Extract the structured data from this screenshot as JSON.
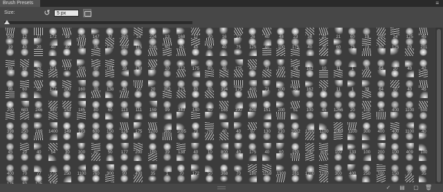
{
  "panel": {
    "tab_title": "Brush Presets",
    "menu_icon": "panel-menu-icon"
  },
  "toolbar": {
    "size_label": "Size:",
    "size_value": "5 px",
    "reset_icon": "reset-size-icon",
    "new_preset_icon": "create-new-preset-icon",
    "size_slider_position": 0
  },
  "brushes": {
    "rows": [
      [
        "500",
        "12",
        "77",
        "172",
        "99",
        "100",
        "147",
        "37",
        "360",
        "24",
        "224",
        "13",
        "168",
        "17",
        "30",
        "16",
        "22",
        "26",
        "40",
        "48",
        "23",
        "36",
        "21",
        "21",
        "60",
        "19",
        "100",
        "24",
        "125",
        "45"
      ],
      [
        "19",
        "40",
        "20",
        "40",
        "40",
        "40",
        "35",
        "125",
        "100",
        "115",
        "556",
        "60",
        "40",
        "40",
        "55",
        "40",
        "75",
        "125",
        "40",
        "100",
        "175",
        "40",
        "20",
        "60",
        "75",
        "73",
        "80",
        "125",
        "60",
        "201"
      ],
      [
        "",
        "",
        "",
        "",
        "",
        "",
        "",
        "",
        "",
        "",
        "",
        "",
        "",
        "",
        "",
        "",
        "",
        "",
        "",
        "",
        "",
        "",
        "",
        "",
        "",
        "",
        "",
        "",
        "",
        ""
      ],
      [
        "69",
        "58",
        "50",
        "151",
        "177",
        "200",
        "80",
        "161",
        "39",
        "138",
        "40",
        "20",
        "212",
        "175",
        "60",
        "46",
        "175",
        "400",
        "71",
        "200",
        "50",
        "162",
        "10",
        "11",
        "1",
        "39",
        "64",
        "20",
        "40",
        "42"
      ],
      [
        "",
        "",
        "",
        "",
        "",
        "",
        "",
        "",
        "",
        "",
        "",
        "",
        "",
        "",
        "",
        "",
        "",
        "",
        "",
        "",
        "",
        "",
        "",
        "",
        "",
        "",
        "",
        "",
        "",
        ""
      ],
      [
        "98",
        "60",
        "55",
        "177",
        "200",
        "160",
        "39",
        "138",
        "40",
        "20",
        "20",
        "302",
        "175",
        "80",
        "60",
        "394",
        "175",
        "400",
        "71",
        "200",
        "50",
        "162",
        "10",
        "11",
        "1",
        "39",
        "64",
        "20",
        "40",
        "45"
      ],
      [
        "",
        "",
        "",
        "",
        "",
        "",
        "",
        "",
        "",
        "",
        "",
        "",
        "",
        "",
        "",
        "",
        "",
        "",
        "",
        "",
        "",
        "",
        "",
        "",
        "",
        "",
        "",
        "",
        "",
        ""
      ],
      [
        "200",
        "683",
        "246",
        "385",
        "153",
        "185",
        "80",
        "60",
        "113",
        "111",
        "159",
        "99",
        "340",
        "140",
        "60",
        "165",
        "190",
        "600",
        "151",
        "200",
        "51",
        "100",
        "45",
        "1266",
        "20",
        "100",
        "26",
        "400",
        "1100",
        "500"
      ],
      [
        "",
        "",
        "",
        "",
        "",
        "",
        "",
        "",
        "",
        "",
        "",
        "",
        "",
        "",
        "",
        "",
        "",
        "",
        "",
        "",
        "",
        "",
        "",
        "",
        "",
        "",
        "",
        "",
        "",
        ""
      ],
      [
        "398",
        "250",
        "169",
        "1400",
        "149",
        "193",
        "600",
        "150",
        "126",
        "175",
        "1200",
        "300",
        "1085",
        "70",
        "700",
        "40",
        "40",
        "87",
        "130",
        "210",
        "1682",
        "1300",
        "1100",
        "1069",
        "1100",
        "300",
        "400",
        "400",
        "1100",
        "40"
      ],
      [
        "",
        "",
        "",
        "",
        "",
        "",
        "",
        "",
        "",
        "",
        "",
        "",
        "",
        "",
        "",
        "",
        "",
        "",
        "",
        "",
        "",
        "",
        "",
        "",
        "",
        "",
        "",
        "",
        "",
        ""
      ],
      [
        "45",
        "20",
        "40",
        "54",
        "30",
        "300",
        "40",
        "50",
        "177",
        "200",
        "160",
        "39",
        "138",
        "40",
        "10",
        "800",
        "40",
        "175",
        "40",
        "60",
        "150",
        "200",
        "800",
        "100",
        "133",
        "100",
        "200",
        "100",
        "409",
        "100"
      ],
      [
        "",
        "",
        "",
        "",
        "",
        "",
        "",
        "",
        "",
        "",
        "",
        "",
        "",
        "",
        "",
        "",
        "",
        "",
        "",
        "",
        "",
        "",
        "",
        "",
        "",
        "",
        "",
        "",
        "",
        ""
      ],
      [
        "400",
        "70",
        "77",
        "775",
        "250",
        "1100",
        "760",
        "300",
        "90",
        "400",
        "35",
        "1",
        "70",
        "172",
        "50",
        "368",
        "70",
        "180",
        "1159",
        "1300",
        "261",
        "1200",
        "1100",
        "300",
        "400",
        "250",
        "100",
        "150",
        "95",
        "35"
      ],
      [
        "175",
        "80",
        "125",
        "175",
        "",
        "",
        "",
        "",
        "",
        "",
        "",
        "",
        "",
        "",
        "",
        "",
        "",
        "",
        "",
        "",
        "",
        "",
        "",
        "",
        "",
        "",
        "",
        "",
        "",
        ""
      ]
    ]
  },
  "bottom": {
    "icons": [
      "toggle-brush-panel-icon",
      "new-brush-icon",
      "delete-brush-icon"
    ]
  }
}
